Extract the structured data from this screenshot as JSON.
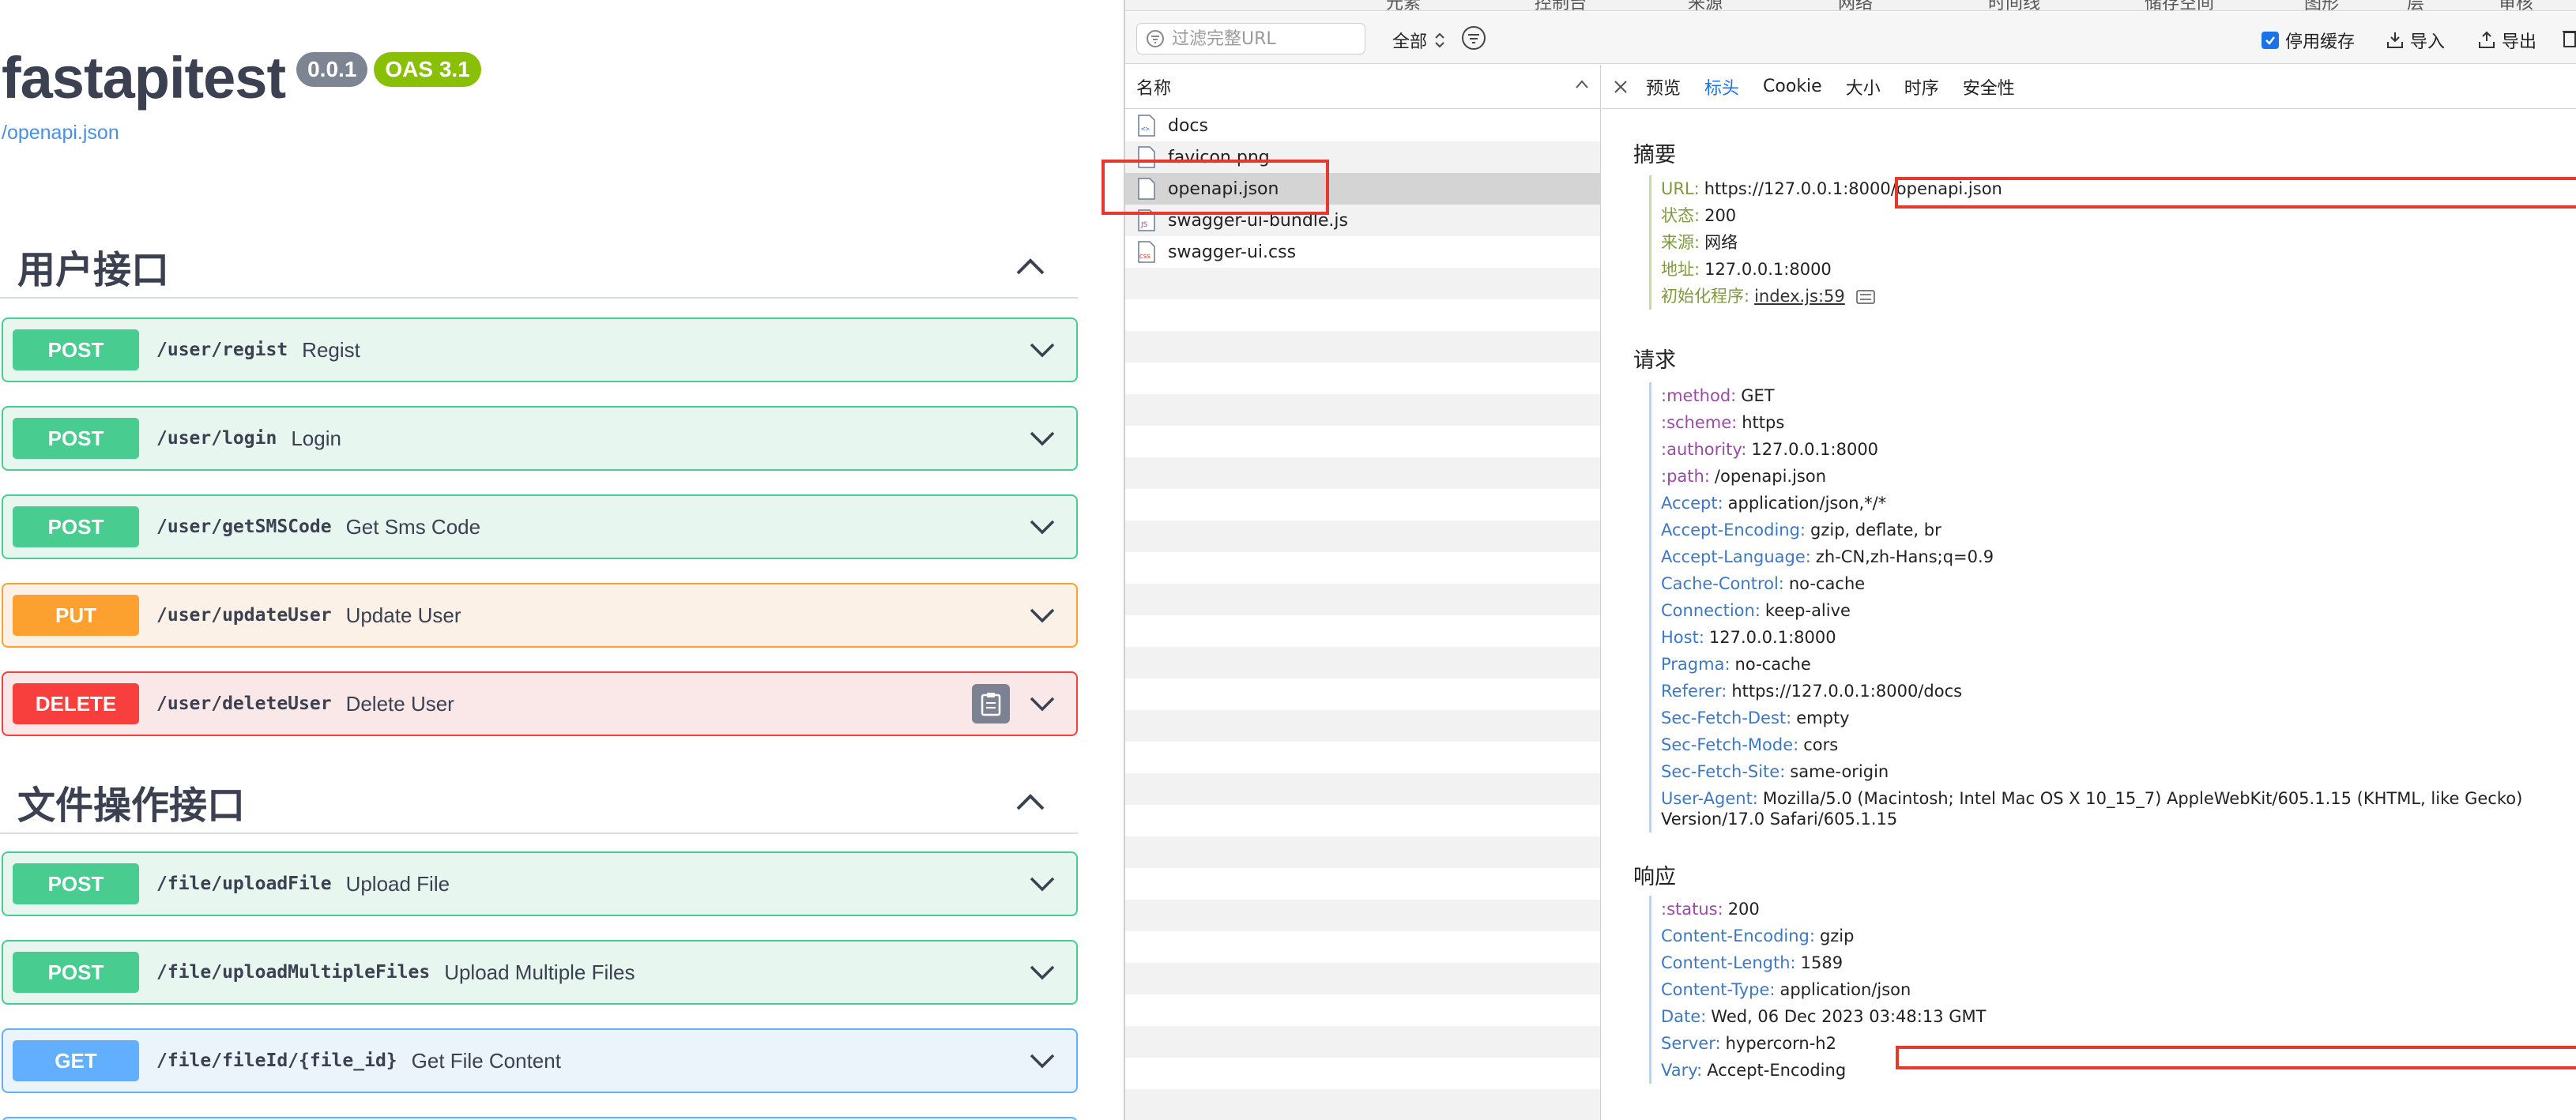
{
  "swagger": {
    "title": "fastapitest",
    "version_badge": "0.0.1",
    "oas_badge": "OAS 3.1",
    "spec_link": "/openapi.json",
    "tags": [
      {
        "name": "用户接口",
        "operations": [
          {
            "method": "POST",
            "path": "/user/regist",
            "summary": "Regist"
          },
          {
            "method": "POST",
            "path": "/user/login",
            "summary": "Login"
          },
          {
            "method": "POST",
            "path": "/user/getSMSCode",
            "summary": "Get Sms Code"
          },
          {
            "method": "PUT",
            "path": "/user/updateUser",
            "summary": "Update User"
          },
          {
            "method": "DELETE",
            "path": "/user/deleteUser",
            "summary": "Delete User"
          }
        ]
      },
      {
        "name": "文件操作接口",
        "operations": [
          {
            "method": "POST",
            "path": "/file/uploadFile",
            "summary": "Upload File"
          },
          {
            "method": "POST",
            "path": "/file/uploadMultipleFiles",
            "summary": "Upload Multiple Files"
          },
          {
            "method": "GET",
            "path": "/file/fileId/{file_id}",
            "summary": "Get File Content"
          }
        ]
      }
    ]
  },
  "devtools": {
    "top_tabs": [
      "元素",
      "控制台",
      "来源",
      "网络",
      "时间线",
      "储存空间",
      "图形",
      "层",
      "审核"
    ],
    "filter_placeholder": "过滤完整URL",
    "type_filter": "全部",
    "disable_cache_label": "停用缓存",
    "import_label": "导入",
    "export_label": "导出",
    "name_column": "名称",
    "files": [
      {
        "name": "docs",
        "type": "html"
      },
      {
        "name": "favicon.png",
        "type": "image"
      },
      {
        "name": "openapi.json",
        "type": "doc"
      },
      {
        "name": "swagger-ui-bundle.js",
        "type": "js"
      },
      {
        "name": "swagger-ui.css",
        "type": "css"
      }
    ],
    "detail_tabs": [
      "预览",
      "标头",
      "Cookie",
      "大小",
      "时序",
      "安全性"
    ],
    "active_tab": "标头",
    "summary_title": "摘要",
    "summary": [
      {
        "key": "URL:",
        "value": "https://127.0.0.1:8000/openapi.json"
      },
      {
        "key": "状态:",
        "value": "200"
      },
      {
        "key": "来源:",
        "value": "网络"
      },
      {
        "key": "地址:",
        "value": "127.0.0.1:8000"
      },
      {
        "key": "初始化程序:",
        "value": "index.js:59"
      }
    ],
    "request_title": "请求",
    "request_pseudo": [
      {
        "key": ":method:",
        "value": "GET"
      },
      {
        "key": ":scheme:",
        "value": "https"
      },
      {
        "key": ":authority:",
        "value": "127.0.0.1:8000"
      },
      {
        "key": ":path:",
        "value": "/openapi.json"
      }
    ],
    "request_headers": [
      {
        "key": "Accept:",
        "value": "application/json,*/*"
      },
      {
        "key": "Accept-Encoding:",
        "value": "gzip, deflate, br"
      },
      {
        "key": "Accept-Language:",
        "value": "zh-CN,zh-Hans;q=0.9"
      },
      {
        "key": "Cache-Control:",
        "value": "no-cache"
      },
      {
        "key": "Connection:",
        "value": "keep-alive"
      },
      {
        "key": "Host:",
        "value": "127.0.0.1:8000"
      },
      {
        "key": "Pragma:",
        "value": "no-cache"
      },
      {
        "key": "Referer:",
        "value": "https://127.0.0.1:8000/docs"
      },
      {
        "key": "Sec-Fetch-Dest:",
        "value": "empty"
      },
      {
        "key": "Sec-Fetch-Mode:",
        "value": "cors"
      },
      {
        "key": "Sec-Fetch-Site:",
        "value": "same-origin"
      }
    ],
    "user_agent": {
      "key": "User-Agent:",
      "value": "Mozilla/5.0 (Macintosh; Intel Mac OS X 10_15_7) AppleWebKit/605.1.15 (KHTML, like Gecko) Version/17.0 Safari/605.1.15"
    },
    "response_title": "响应",
    "response_pseudo": [
      {
        "key": ":status:",
        "value": "200"
      }
    ],
    "response_headers": [
      {
        "key": "Content-Encoding:",
        "value": "gzip"
      },
      {
        "key": "Content-Length:",
        "value": "1589"
      },
      {
        "key": "Content-Type:",
        "value": "application/json"
      },
      {
        "key": "Date:",
        "value": "Wed, 06 Dec 2023 03:48:13 GMT"
      },
      {
        "key": "Server:",
        "value": "hypercorn-h2"
      },
      {
        "key": "Vary:",
        "value": "Accept-Encoding"
      }
    ]
  },
  "colors": {
    "post": "#49cc90",
    "put": "#fca130",
    "delete": "#f93e3e",
    "get": "#61affe",
    "highlight": "#e8382b",
    "devtools_accent": "#1a73e8"
  }
}
